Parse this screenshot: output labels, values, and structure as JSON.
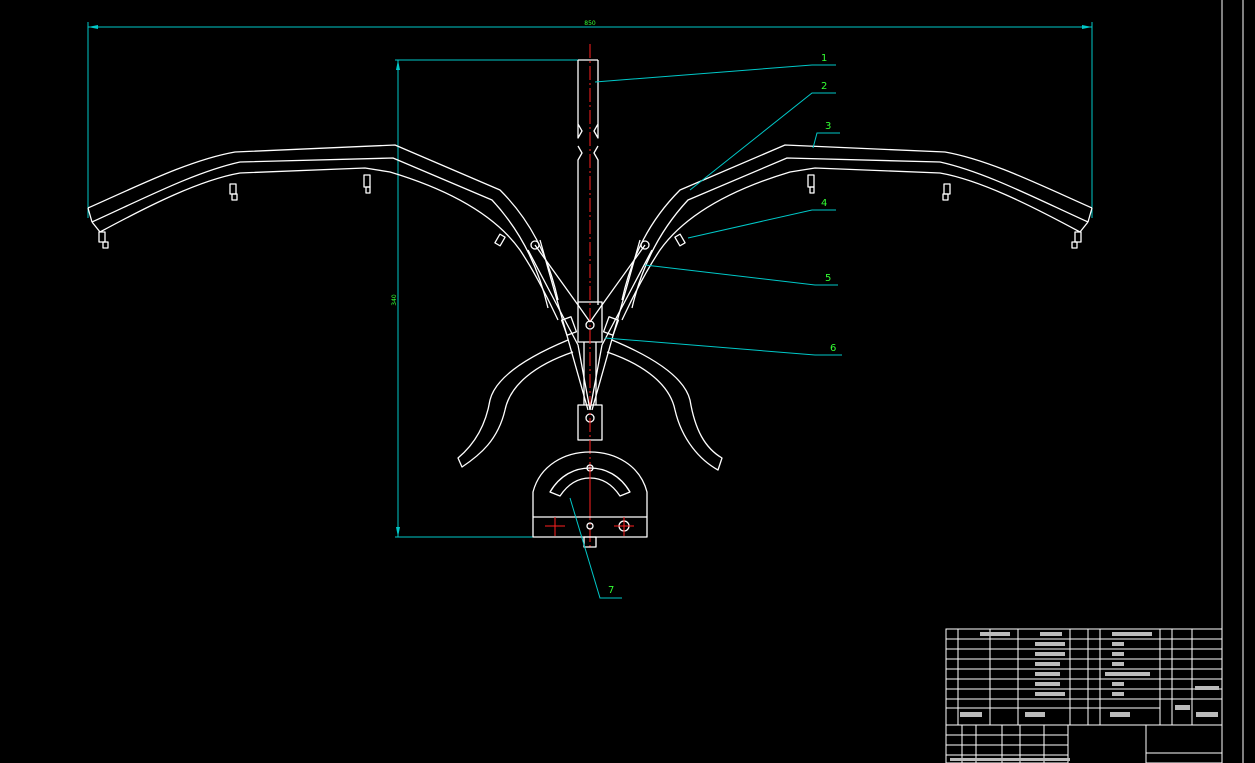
{
  "drawing": {
    "overall_width_dim": "850",
    "height_dim": "340",
    "leader_numbers": [
      "1",
      "2",
      "3",
      "4",
      "5",
      "6",
      "7"
    ]
  },
  "colors": {
    "background": "#000000",
    "outline": "#ffffff",
    "dimension": "#00c8c8",
    "centerline": "#ff2020",
    "labels": "#33ff33"
  }
}
